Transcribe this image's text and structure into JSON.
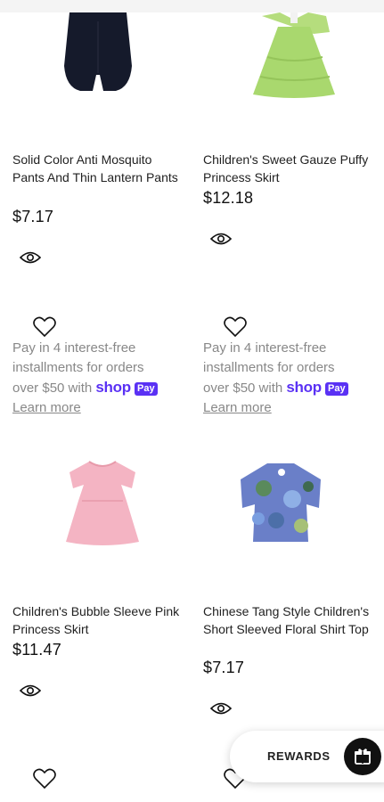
{
  "products": [
    {
      "title": "Solid Color Anti Mosquito Pants And Thin Lantern Pants",
      "price": "$7.17"
    },
    {
      "title": "Children's Sweet Gauze Puffy Princess Skirt",
      "price": "$12.18"
    },
    {
      "title": "Children's Bubble Sleeve Pink Princess Skirt",
      "price": "$11.47"
    },
    {
      "title": "Chinese Tang Style Children's Short Sleeved Floral Shirt Top",
      "price": "$7.17"
    }
  ],
  "installments": {
    "line1": "Pay in 4 interest-free",
    "line2": "installments for orders",
    "line3": "over $50 with",
    "shop": "shop",
    "pay": "Pay",
    "learn_more": "Learn more"
  },
  "rewards": {
    "label": "REWARDS"
  },
  "colors": {
    "shop_pay": "#5a31f4",
    "rewards_button": "#111111"
  },
  "icons": [
    "eye-icon",
    "heart-icon",
    "gift-icon"
  ]
}
